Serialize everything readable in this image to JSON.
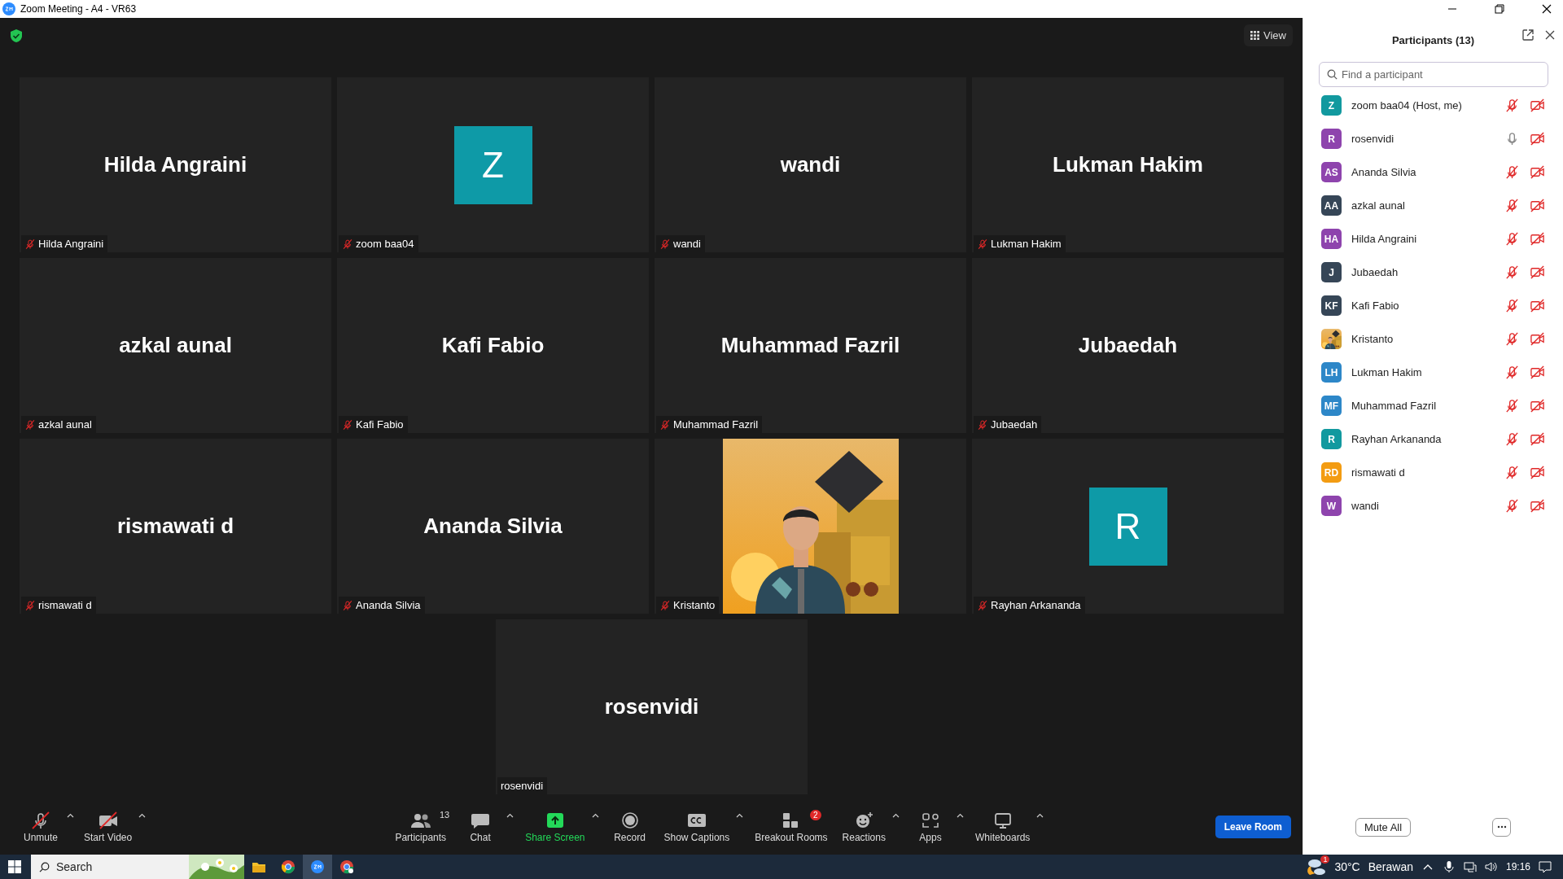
{
  "window": {
    "title": "Zoom Meeting - A4 - VR63"
  },
  "meeting": {
    "view_label": "View"
  },
  "tiles": [
    {
      "kind": "name",
      "display": "Hilda Angraini",
      "label": "Hilda Angraini",
      "muted": true
    },
    {
      "kind": "avatar",
      "display": "Z",
      "label": "zoom baa04",
      "muted": true
    },
    {
      "kind": "name",
      "display": "wandi",
      "label": "wandi",
      "muted": true
    },
    {
      "kind": "name",
      "display": "Lukman Hakim",
      "label": "Lukman Hakim",
      "muted": true
    },
    {
      "kind": "name",
      "display": "azkal aunal",
      "label": "azkal aunal",
      "muted": true
    },
    {
      "kind": "name",
      "display": "Kafi Fabio",
      "label": "Kafi Fabio",
      "muted": true
    },
    {
      "kind": "name",
      "display": "Muhammad Fazril",
      "label": "Muhammad Fazril",
      "muted": true
    },
    {
      "kind": "name",
      "display": "Jubaedah",
      "label": "Jubaedah",
      "muted": true
    },
    {
      "kind": "name",
      "display": "rismawati d",
      "label": "rismawati d",
      "muted": true
    },
    {
      "kind": "name",
      "display": "Ananda Silvia",
      "label": "Ananda Silvia",
      "muted": true
    },
    {
      "kind": "video",
      "label": "Kristanto",
      "muted": true
    },
    {
      "kind": "avatar",
      "display": "R",
      "label": "Rayhan Arkananda",
      "muted": true
    },
    {
      "kind": "name",
      "display": "rosenvidi",
      "label": "rosenvidi",
      "muted": false
    }
  ],
  "toolbar": {
    "left_items": [
      {
        "label": "Unmute",
        "menu": true,
        "off": true
      },
      {
        "label": "Start Video",
        "menu": true,
        "off": true
      }
    ],
    "center_items": [
      {
        "label": "Participants",
        "count": "13",
        "menu": false
      },
      {
        "label": "Chat",
        "menu": true
      },
      {
        "label": "Share Screen",
        "menu": true,
        "highlight": true
      },
      {
        "label": "Record",
        "menu": false
      },
      {
        "label": "Show Captions",
        "menu": true
      },
      {
        "label": "Breakout Rooms",
        "badge": "2",
        "menu": false
      },
      {
        "label": "Reactions",
        "menu": true
      },
      {
        "label": "Apps",
        "menu": true
      },
      {
        "label": "Whiteboards",
        "menu": true
      }
    ],
    "leave_button": "Leave Room"
  },
  "participants_panel": {
    "title": "Participants (13)",
    "search": {
      "placeholder": "Find a participant"
    },
    "participants": [
      {
        "kind": "initials",
        "initials": "Z",
        "name": "zoom baa04 (Host, me)",
        "color": "#12999f",
        "mic_muted": true,
        "video_off": true
      },
      {
        "kind": "initials",
        "initials": "R",
        "name": "rosenvidi",
        "color": "#8e44ad",
        "mic_muted": false,
        "video_off": true
      },
      {
        "kind": "initials",
        "initials": "AS",
        "name": "Ananda Silvia",
        "color": "#8e44ad",
        "mic_muted": true,
        "video_off": true
      },
      {
        "kind": "initials",
        "initials": "AA",
        "name": "azkal aunal",
        "color": "#364657",
        "mic_muted": true,
        "video_off": true
      },
      {
        "kind": "initials",
        "initials": "HA",
        "name": "Hilda Angraini",
        "color": "#8e44ad",
        "mic_muted": true,
        "video_off": true
      },
      {
        "kind": "initials",
        "initials": "J",
        "name": "Jubaedah",
        "color": "#364657",
        "mic_muted": true,
        "video_off": true
      },
      {
        "kind": "initials",
        "initials": "KF",
        "name": "Kafi Fabio",
        "color": "#364657",
        "mic_muted": true,
        "video_off": true
      },
      {
        "kind": "picture",
        "name": "Kristanto",
        "mic_muted": true,
        "video_off": true
      },
      {
        "kind": "initials",
        "initials": "LH",
        "name": "Lukman Hakim",
        "color": "#2d87c8",
        "mic_muted": true,
        "video_off": true
      },
      {
        "kind": "initials",
        "initials": "MF",
        "name": "Muhammad Fazril",
        "color": "#2d87c8",
        "mic_muted": true,
        "video_off": true
      },
      {
        "kind": "initials",
        "initials": "R",
        "name": "Rayhan Arkananda",
        "color": "#12999f",
        "mic_muted": true,
        "video_off": true
      },
      {
        "kind": "initials",
        "initials": "RD",
        "name": "rismawati d",
        "color": "#f39c12",
        "mic_muted": true,
        "video_off": true
      },
      {
        "kind": "initials",
        "initials": "W",
        "name": "wandi",
        "color": "#8e44ad",
        "mic_muted": true,
        "video_off": true
      }
    ],
    "mute_all_button": "Mute All"
  },
  "taskbar": {
    "search_placeholder": "Search",
    "weather_badge": "1",
    "temperature": "30°C",
    "weather": "Berawan",
    "time": "19:16"
  }
}
